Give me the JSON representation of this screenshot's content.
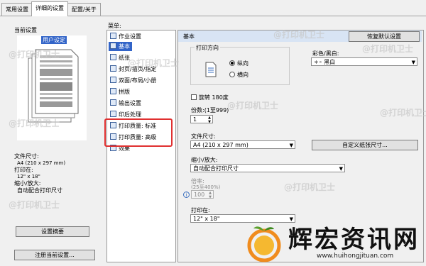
{
  "tabs": [
    "常用设置",
    "详细的设置",
    "配置/关于"
  ],
  "left": {
    "current_settings_label": "当前设置",
    "selected_label": "用户设定",
    "paper_size_label": "文件尺寸:",
    "paper_size_value": "A4 (210 x 297 mm)",
    "print_on_label": "打印在:",
    "print_on_value": "12\" x 18\"",
    "scale_label": "缩小/放大:",
    "scale_value": "自动配合打印尺寸",
    "summary_button": "设置摘要",
    "register_button": "注册当前设置..."
  },
  "menu": {
    "label": "菜单:",
    "items": [
      "作业设置",
      "基本",
      "纸张",
      "封页/插页/指定",
      "双面/布局/小册",
      "拼版",
      "输出设置",
      "印后处理",
      "打印质量: 标准",
      "打印质量: 高级",
      "效果"
    ],
    "selected_index": 1
  },
  "panel": {
    "title": "基本",
    "restore_button": "恢复默认设置",
    "orientation_label": "打印方向",
    "portrait": "纵向",
    "landscape": "横向",
    "color_label": "彩色/黑白:",
    "color_value": "黑白",
    "rotate_label": "旋转 180度",
    "copies_label": "份数:(1至999)",
    "copies_value": "1",
    "paper_size_label": "文件尺寸:",
    "paper_size_value": "A4 (210 x 297 mm)",
    "custom_paper_button": "自定义纸张尺寸...",
    "scale_label": "缩小/放大:",
    "scale_value": "自动配合打印尺寸",
    "ratio_label": "倍率:",
    "ratio_range": "(25至400%)",
    "ratio_value": "100",
    "print_on_label": "打印在:",
    "print_on_value": "12\" x 18\""
  },
  "watermark": "@打印机卫士",
  "brand": {
    "name": "辉宏资讯网",
    "url": "www.huihongjituan.com"
  },
  "colors": {
    "accent": "#3264c8",
    "highlight_box": "#e03030",
    "brand_orange": "#f08c1e"
  }
}
